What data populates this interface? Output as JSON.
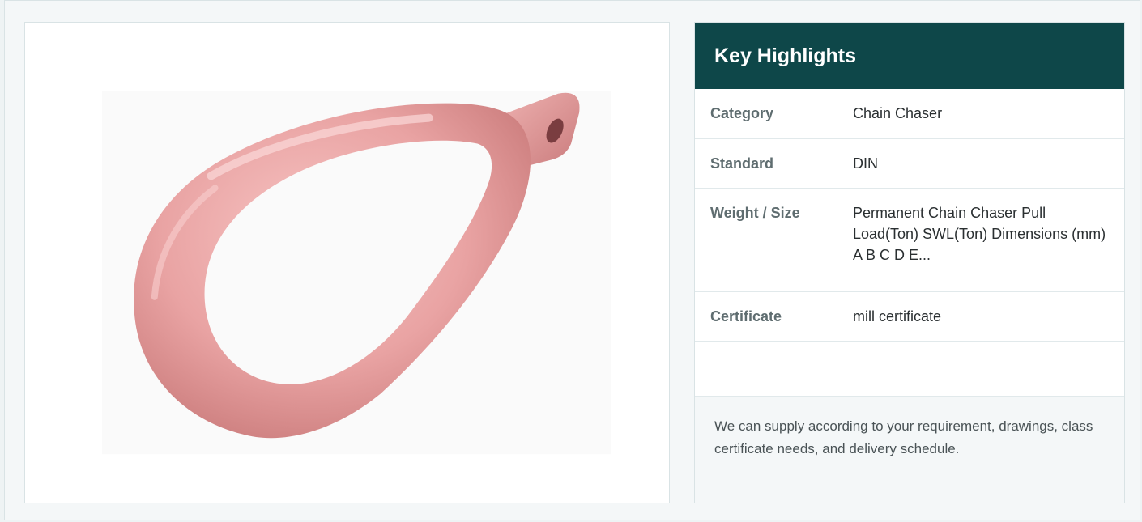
{
  "product": {
    "image_alt": "Permanent Chain Chaser",
    "image_color": "#e79a9c"
  },
  "highlights": {
    "title": "Key Highlights",
    "rows": [
      {
        "label": "Category",
        "value": "Chain Chaser"
      },
      {
        "label": "Standard",
        "value": "DIN"
      },
      {
        "label": "Weight / Size",
        "value": "Permanent Chain Chaser Pull Load(Ton) SWL(Ton) Dimensions (mm) A B C D E..."
      },
      {
        "label": "Certificate",
        "value": "mill certificate"
      }
    ],
    "note": "We can supply according to your requirement, drawings, class certificate needs, and delivery schedule."
  },
  "colors": {
    "header_bg": "#0e4749",
    "page_bg": "#f4f7f8",
    "border": "#d9e3e5"
  }
}
